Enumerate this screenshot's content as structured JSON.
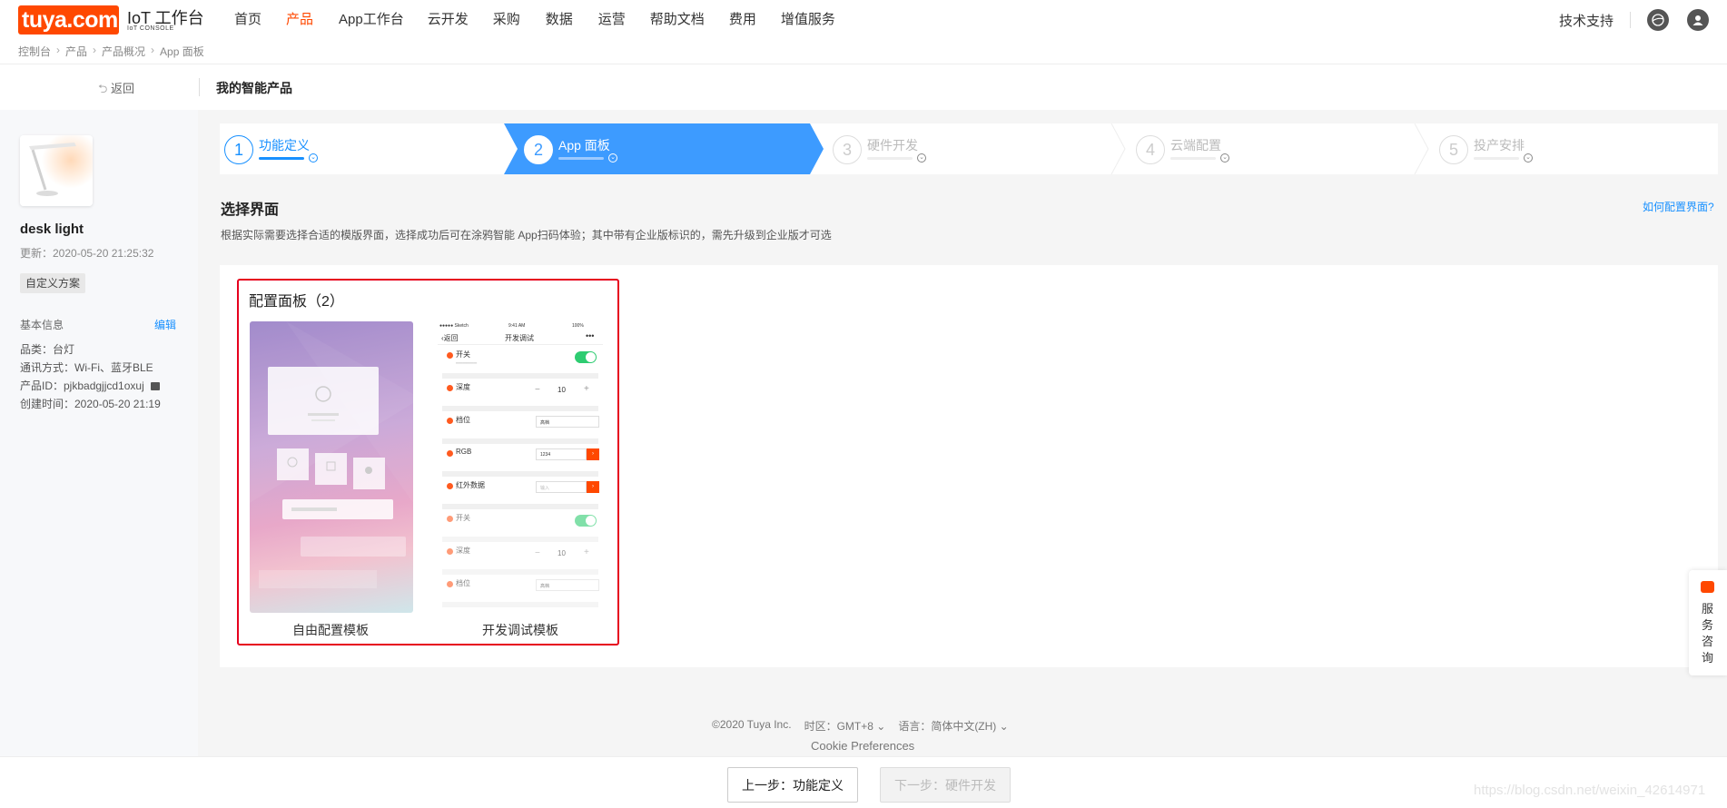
{
  "header": {
    "logo_text": "tuya.com",
    "console_title": "IoT 工作台",
    "console_subtitle": "IoT CONSOLE",
    "nav": [
      "首页",
      "产品",
      "App工作台",
      "云开发",
      "采购",
      "数据",
      "运营",
      "帮助文档",
      "费用",
      "增值服务"
    ],
    "active_nav": "产品",
    "support": "技术支持"
  },
  "breadcrumb": [
    "控制台",
    "产品",
    "产品概况",
    "App 面板"
  ],
  "subheader": {
    "back": "返回",
    "title": "我的智能产品"
  },
  "product": {
    "name": "desk light",
    "updated": "更新：2020-05-20 21:25:32",
    "tag": "自定义方案",
    "basic_info_label": "基本信息",
    "edit": "编辑",
    "info": [
      "品类：台灯",
      "通讯方式：Wi-Fi、蓝牙BLE",
      "产品ID：pjkbadgjjcd1oxuj",
      "创建时间：2020-05-20 21:19"
    ]
  },
  "steps": [
    {
      "num": "1",
      "label": "功能定义",
      "state": "done"
    },
    {
      "num": "2",
      "label": "App 面板",
      "state": "active"
    },
    {
      "num": "3",
      "label": "硬件开发",
      "state": "pending"
    },
    {
      "num": "4",
      "label": "云端配置",
      "state": "pending"
    },
    {
      "num": "5",
      "label": "投产安排",
      "state": "pending"
    }
  ],
  "section": {
    "title": "选择界面",
    "help": "如何配置界面?",
    "desc": "根据实际需要选择合适的模版界面，选择成功后可在涂鸦智能 App扫码体验；其中带有企业版标识的，需先升级到企业版才可选"
  },
  "config_panel": {
    "title": "配置面板（2）",
    "templates": [
      "自由配置模板",
      "开发调试模板"
    ],
    "phone": {
      "status_left": "●●●●● Sketch",
      "status_time": "9:41 AM",
      "status_right": "100%",
      "back": "返回",
      "title": "开发调试",
      "rows": [
        "开关",
        "深度",
        "档位",
        "RGB",
        "红外数据",
        "开关",
        "深度",
        "档位"
      ],
      "stepper_value": "10",
      "select_value": "高档",
      "rgb_value": "1234",
      "ir_placeholder": "输入"
    }
  },
  "footer": {
    "copyright": "©2020 Tuya Inc.",
    "timezone": "时区：GMT+8",
    "language": "语言：简体中文(ZH)",
    "cookie": "Cookie Preferences"
  },
  "actions": {
    "prev": "上一步：功能定义",
    "next": "下一步：硬件开发"
  },
  "service": "服务咨询",
  "watermark": "https://blog.csdn.net/weixin_42614971",
  "colors": {
    "brand": "#ff4800",
    "accent": "#1890ff",
    "highlight": "#e6001e"
  }
}
